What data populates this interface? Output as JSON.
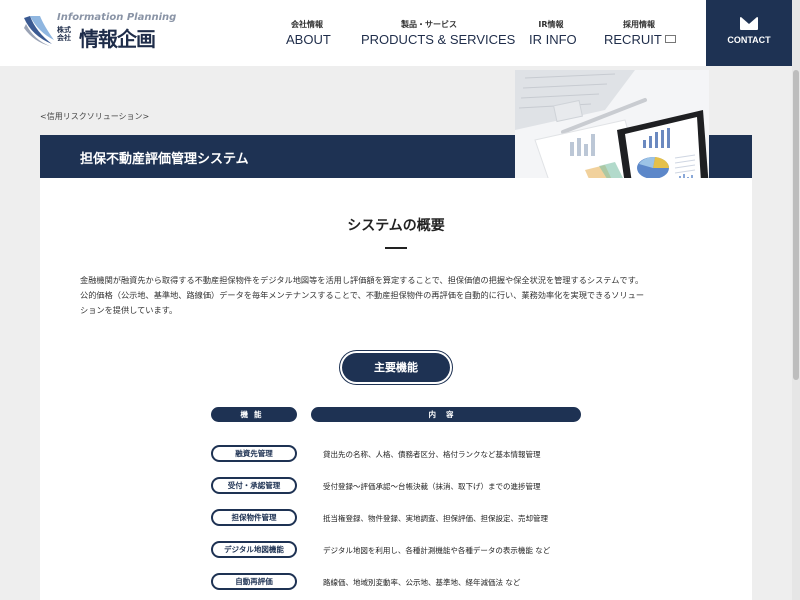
{
  "header": {
    "logo": {
      "english": "Information Planning",
      "kabushiki": "株式会社",
      "name": "情報企画"
    },
    "nav": [
      {
        "jp": "会社情報",
        "en": "ABOUT"
      },
      {
        "jp": "製品・サービス",
        "en": "PRODUCTS & SERVICES"
      },
      {
        "jp": "IR情報",
        "en": "IR INFO"
      },
      {
        "jp": "採用情報",
        "en": "RECRUIT"
      }
    ],
    "contact_label": "CONTACT"
  },
  "breadcrumb": "<信用リスクソリューション>",
  "page_title": "担保不動産評価管理システム",
  "overview": {
    "title": "システムの概要",
    "description_lines": [
      "金融機関が融資先から取得する不動産担保物件をデジタル地図等を活用し評価額を算定することで、担保価値の把握や保全状況を管理するシステムです。",
      "公的価格（公示地、基準地、路線価）データを毎年メンテナンスすることで、不動産担保物件の再評価を自動的に行い、業務効率化を実現できるソリュー",
      "ションを提供しています。"
    ]
  },
  "features": {
    "button_label": "主要機能",
    "header_function": "機能",
    "header_content": "内容",
    "rows": [
      {
        "function": "融資先管理",
        "content": "貸出先の名称、人格、債務者区分、格付ランクなど基本情報管理"
      },
      {
        "function": "受付・承認管理",
        "content": "受付登録～評価承認～台帳決裁（抹消、取下げ）までの進捗管理"
      },
      {
        "function": "担保物件管理",
        "content": "抵当権登録、物件登録、実地調査、担保評価、担保設定、売却管理"
      },
      {
        "function": "デジタル地図機能",
        "content": "デジタル地図を利用し、各種計測機能や各種データの表示機能 など"
      },
      {
        "function": "自動再評価",
        "content": "路線価、地域別変動率、公示地、基準地、経年減価法 など"
      }
    ]
  },
  "colors": {
    "navy": "#1e3253",
    "background": "#eeeeee"
  }
}
